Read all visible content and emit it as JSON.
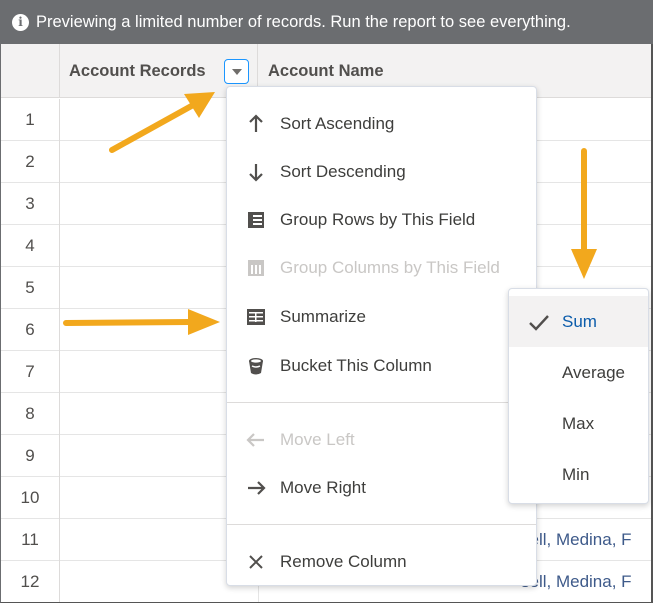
{
  "banner": {
    "icon": "info-icon",
    "text": "Previewing a limited number of records. Run the report to see everything."
  },
  "columns": {
    "account_records": "Account Records",
    "account_name": "Account Name"
  },
  "rows": [
    {
      "num": "1",
      "name": ""
    },
    {
      "num": "2",
      "name": ""
    },
    {
      "num": "3",
      "name": ""
    },
    {
      "num": "4",
      "name": ""
    },
    {
      "num": "5",
      "name": ""
    },
    {
      "num": "6",
      "name": ""
    },
    {
      "num": "7",
      "name": ""
    },
    {
      "num": "8",
      "name": ""
    },
    {
      "num": "9",
      "name": ""
    },
    {
      "num": "10",
      "name": ""
    },
    {
      "num": "11",
      "name": "sell, Medina, F"
    },
    {
      "num": "12",
      "name": "sell, Medina, F"
    }
  ],
  "menu": {
    "sort_ascending": "Sort Ascending",
    "sort_descending": "Sort Descending",
    "group_rows": "Group Rows by This Field",
    "group_columns": "Group Columns by This Field",
    "summarize": "Summarize",
    "bucket": "Bucket This Column",
    "move_left": "Move Left",
    "move_right": "Move Right",
    "remove_column": "Remove Column"
  },
  "submenu": {
    "sum": "Sum",
    "average": "Average",
    "max": "Max",
    "min": "Min",
    "selected": "Sum"
  },
  "colors": {
    "banner_bg": "#6b6d70",
    "accent_blue": "#1b96ff",
    "link_blue": "#3e5a8a",
    "annotation_arrow": "#f2a81d"
  }
}
